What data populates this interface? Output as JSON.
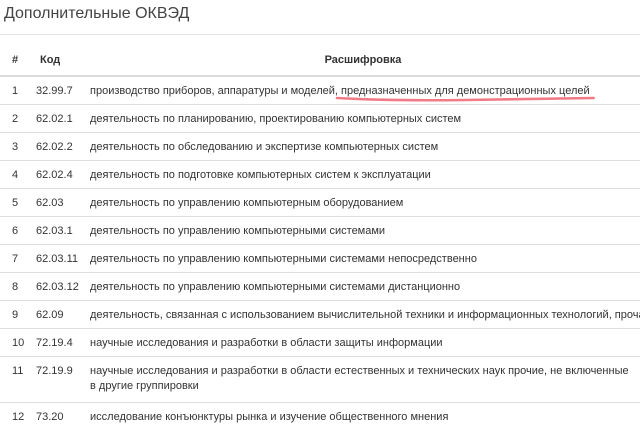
{
  "section_title": "Дополнительные ОКВЭД",
  "colors": {
    "highlight_underline": "#f07a85",
    "row_border": "#dddddd",
    "text": "#333333"
  },
  "table": {
    "headers": {
      "num": "#",
      "code": "Код",
      "description": "Расшифровка"
    },
    "rows": [
      {
        "num": "1",
        "code": "32.99.7",
        "description": "производство приборов, аппаратуры и моделей, ",
        "description_highlight": "предназначенных для демонстрационных целей"
      },
      {
        "num": "2",
        "code": "62.02.1",
        "description": "деятельность по планированию, проектированию компьютерных систем"
      },
      {
        "num": "3",
        "code": "62.02.2",
        "description": "деятельность по обследованию и экспертизе компьютерных систем"
      },
      {
        "num": "4",
        "code": "62.02.4",
        "description": "деятельность по подготовке компьютерных систем к эксплуатации"
      },
      {
        "num": "5",
        "code": "62.03",
        "description": "деятельность по управлению компьютерным оборудованием"
      },
      {
        "num": "6",
        "code": "62.03.1",
        "description": "деятельность по управлению компьютерными системами"
      },
      {
        "num": "7",
        "code": "62.03.11",
        "description": "деятельность по управлению компьютерными системами непосредственно"
      },
      {
        "num": "8",
        "code": "62.03.12",
        "description": "деятельность по управлению компьютерными системами дистанционно"
      },
      {
        "num": "9",
        "code": "62.09",
        "description": "деятельность, связанная с использованием вычислительной техники и информационных технологий, прочая"
      },
      {
        "num": "10",
        "code": "72.19.4",
        "description": "научные исследования и разработки в области защиты информации"
      },
      {
        "num": "11",
        "code": "72.19.9",
        "description": "научные исследования и разработки в области естественных и технических наук прочие, не включенные в другие группировки"
      },
      {
        "num": "12",
        "code": "73.20",
        "description": "исследование конъюнктуры рынка и изучение общественного мнения"
      }
    ]
  }
}
